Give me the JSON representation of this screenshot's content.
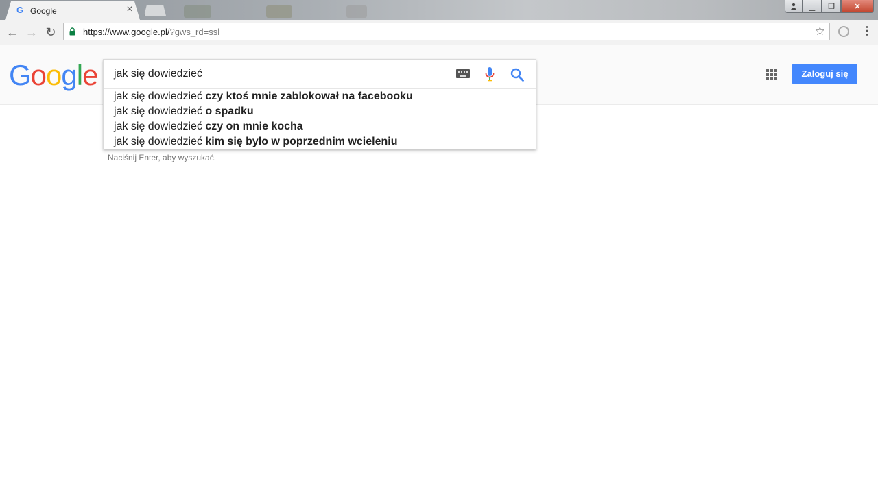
{
  "browser": {
    "tab_title": "Google",
    "tab_favicon": "G",
    "tab_close": "×",
    "url_main": "https://www.google.pl/",
    "url_rest": "?gws_rd=ssl",
    "icons": {
      "back": "←",
      "forward": "→",
      "reload": "↻",
      "star": "☆",
      "menu": "⋮"
    },
    "window_controls": {
      "minimize": "▁",
      "maximize": "❐",
      "close": "✕"
    }
  },
  "google": {
    "logo_letters": [
      {
        "char": "G",
        "color": "#4285F4"
      },
      {
        "char": "o",
        "color": "#EA4335"
      },
      {
        "char": "o",
        "color": "#FBBC05"
      },
      {
        "char": "g",
        "color": "#4285F4"
      },
      {
        "char": "l",
        "color": "#34A853"
      },
      {
        "char": "e",
        "color": "#EA4335"
      }
    ],
    "signin_label": "Zaloguj się",
    "query": "jak się dowiedzieć",
    "suggestions": [
      {
        "prefix": "jak się dowiedzieć",
        "completion": "czy ktoś mnie zablokował na facebooku"
      },
      {
        "prefix": "jak się dowiedzieć",
        "completion": "o spadku"
      },
      {
        "prefix": "jak się dowiedzieć",
        "completion": "czy on mnie kocha"
      },
      {
        "prefix": "jak się dowiedzieć",
        "completion": "kim się było w poprzednim wcieleniu"
      }
    ],
    "hint": "Naciśnij Enter, aby wyszukać."
  },
  "colors": {
    "accent_blue": "#4387FD",
    "lock_green": "#0B8043"
  }
}
